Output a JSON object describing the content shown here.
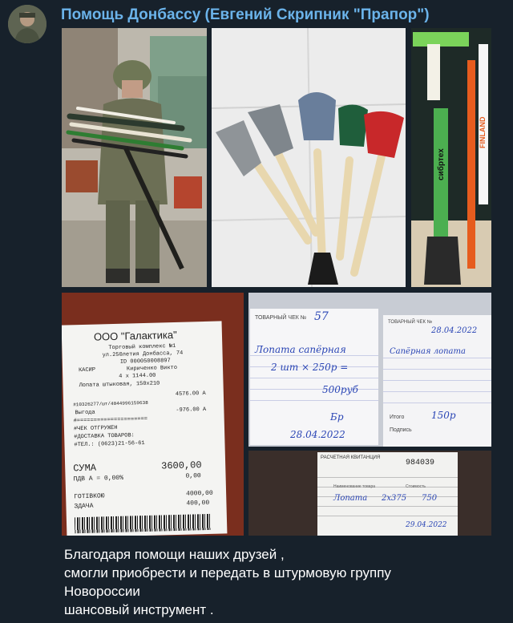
{
  "channel": {
    "title": "Помощь Донбассу (Евгений Скрипник \"Прапор\")"
  },
  "photos": {
    "soldier": {
      "alt": "soldier-with-shovels"
    },
    "shovels": {
      "alt": "shovels-on-floor"
    },
    "store": {
      "alt": "store-shovels",
      "brand1": "сибртех",
      "brand2": "FINLAND"
    }
  },
  "receipt1": {
    "store": "ООО \"Галактика\"",
    "line1": "Торговый комплекс №1",
    "line2": "ул.250летия Донбасса, 74",
    "line3": "ID 000050008897",
    "cashier_label": "КАСИР",
    "cashier": "Кириченко Викто",
    "qty": "4 x 1144.00",
    "item": "Лопата штыковая, 150х210",
    "item_total": "4576.00 A",
    "code": "#10326277/шт/4044996159638",
    "benefit_label": "Выгода",
    "benefit": "-976.00 A",
    "sep": "#=====================",
    "check_status": "#ЧЕК ОТГРУЖЕН",
    "delivery": "#ДОСТАВКА ТОВАРОВ:",
    "phone": "#ТЕЛ.: (0623)21-56-61",
    "sum_label": "СУМА",
    "sum": "3600,00",
    "vat_label": "ПДВ  А = 0,00%",
    "vat": "0,00",
    "cash_label": "ГОТІВКОЮ",
    "cash": "4000,00",
    "change_label": "ЗДАЧА",
    "change": "400,00"
  },
  "receipt2": {
    "header": "ТОВАРНЫЙ ЧЕК №",
    "number": "57",
    "item": "Лопата сапёрная",
    "calc": "2 шт × 250р =",
    "total": "500руб",
    "sign": "Бр",
    "date": "28.04.2022"
  },
  "receipt3": {
    "header": "ТОВАРНЫЙ ЧЕК №",
    "date": "28.04.2022",
    "item": "Сапёрная лопата",
    "total_label": "Итого",
    "total": "150р",
    "sign_label": "Подпись"
  },
  "receipt4": {
    "header": "РАСЧЕТНАЯ КВИТАНЦИЯ",
    "number": "984039",
    "col1": "Наименование товара",
    "col2": "Стоимость",
    "item": "Лопата",
    "calc": "2х375",
    "total": "750",
    "date": "29.04.2022"
  },
  "caption": {
    "line1": "Благодаря помощи наших друзей ,",
    "line2": "смогли приобрести и передать в штурмовую группу",
    "line3": "Новороссии",
    "line4": "шансовый инструмент ."
  }
}
